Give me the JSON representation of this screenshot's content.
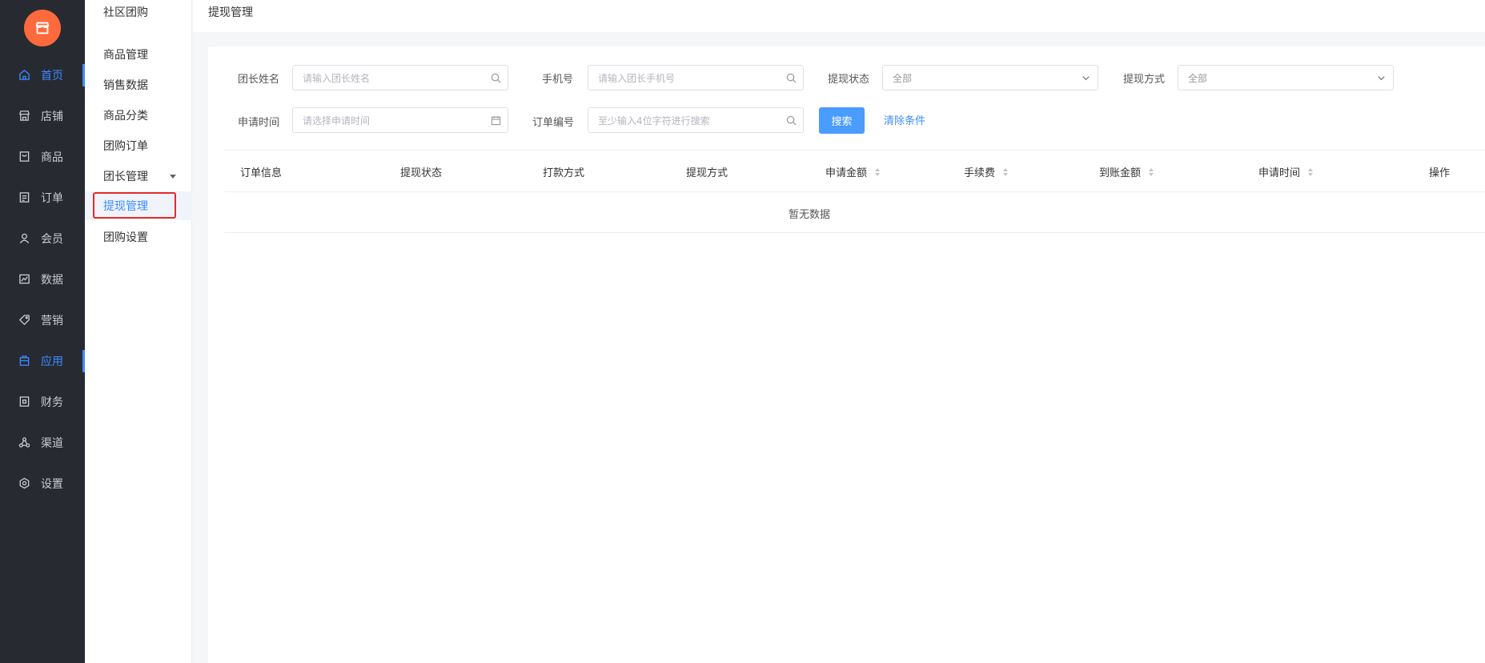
{
  "colors": {
    "brand": "#ff6a3d",
    "accent": "#3b8cff",
    "sidebar_bg": "#282a31",
    "highlight": "#e52a2a"
  },
  "nav": {
    "logo_icon": "shop-icon",
    "items": [
      {
        "label": "首页",
        "icon": "home-icon",
        "active": true
      },
      {
        "label": "店铺",
        "icon": "store-icon"
      },
      {
        "label": "商品",
        "icon": "goods-icon"
      },
      {
        "label": "订单",
        "icon": "order-icon"
      },
      {
        "label": "会员",
        "icon": "user-icon"
      },
      {
        "label": "数据",
        "icon": "chart-icon"
      },
      {
        "label": "营销",
        "icon": "tag-icon"
      },
      {
        "label": "应用",
        "icon": "app-icon",
        "active": true
      },
      {
        "label": "财务",
        "icon": "finance-icon"
      },
      {
        "label": "渠道",
        "icon": "channel-icon"
      },
      {
        "label": "设置",
        "icon": "gear-icon"
      }
    ]
  },
  "submenu": {
    "title": "社区团购",
    "items": [
      {
        "label": "商品管理"
      },
      {
        "label": "销售数据"
      },
      {
        "label": "商品分类"
      },
      {
        "label": "团购订单"
      },
      {
        "label": "团长管理",
        "has_children": true
      },
      {
        "label": "提现管理",
        "active": true
      },
      {
        "label": "团购设置"
      }
    ]
  },
  "header": {
    "breadcrumb": "提现管理"
  },
  "filters": {
    "leader_name": {
      "label": "团长姓名",
      "placeholder": "请输入团长姓名"
    },
    "phone": {
      "label": "手机号",
      "placeholder": "请输入团长手机号"
    },
    "withdraw_status": {
      "label": "提现状态",
      "value": "全部"
    },
    "withdraw_method": {
      "label": "提现方式",
      "value": "全部"
    },
    "apply_time": {
      "label": "申请时间",
      "placeholder": "请选择申请时间"
    },
    "order_no": {
      "label": "订单编号",
      "placeholder": "至少输入4位字符进行搜索"
    },
    "search_label": "搜索",
    "clear_label": "清除条件"
  },
  "table": {
    "columns": [
      {
        "label": "订单信息"
      },
      {
        "label": "提现状态"
      },
      {
        "label": "打款方式"
      },
      {
        "label": "提现方式"
      },
      {
        "label": "申请金额",
        "sortable": true
      },
      {
        "label": "手续费",
        "sortable": true
      },
      {
        "label": "到账金额",
        "sortable": true
      },
      {
        "label": "申请时间",
        "sortable": true
      },
      {
        "label": "操作"
      }
    ],
    "empty_text": "暂无数据"
  }
}
